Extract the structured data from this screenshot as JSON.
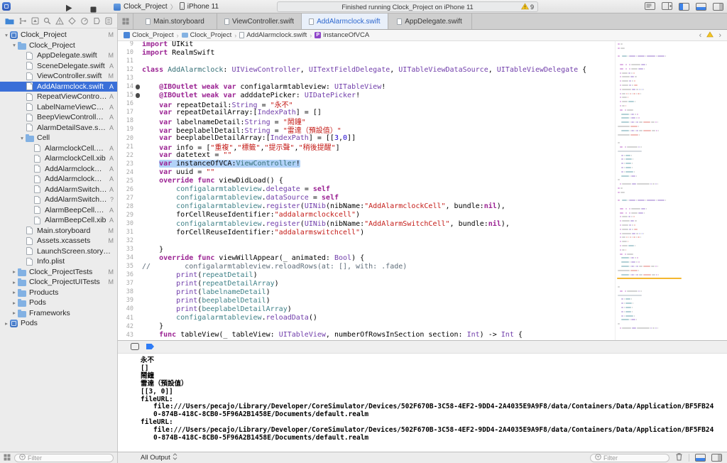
{
  "colors": {
    "selection_blue": "#3a6fd8",
    "tab_active_blue": "#2e68cf",
    "warning_yellow": "#f5c521",
    "keyword_pink": "#9B2393",
    "string_red": "#C41A16",
    "type_purple": "#703DAA",
    "member_teal": "#3E8087",
    "code_selection": "#b3d3f9"
  },
  "toolbar": {
    "scheme_project": "Clock_Project",
    "scheme_device": "iPhone 11",
    "status_text": "Finished running Clock_Project on iPhone 11",
    "warning_count": "9"
  },
  "tabs": [
    {
      "label": "Main.storyboard"
    },
    {
      "label": "ViewController.swift"
    },
    {
      "label": "AddAlarmclock.swift",
      "active": true
    },
    {
      "label": "AppDelegate.swift"
    }
  ],
  "breadcrumb": {
    "items": [
      {
        "label": "Clock_Project",
        "icon": "project"
      },
      {
        "label": "Clock_Project",
        "icon": "folder"
      },
      {
        "label": "AddAlarmclock.swift",
        "icon": "swift-file"
      },
      {
        "label": "instanceOfVCA",
        "icon": "symbol"
      }
    ]
  },
  "sidebar": {
    "filter_placeholder": "Filter",
    "items": [
      {
        "label": "Clock_Project",
        "indent": 0,
        "icon": "project",
        "disc": "open",
        "status": "M"
      },
      {
        "label": "Clock_Project",
        "indent": 1,
        "icon": "folder",
        "disc": "open"
      },
      {
        "label": "AppDelegate.swift",
        "indent": 2,
        "icon": "swift",
        "status": "M"
      },
      {
        "label": "SceneDelegate.swift",
        "indent": 2,
        "icon": "swift",
        "status": "A"
      },
      {
        "label": "ViewController.swift",
        "indent": 2,
        "icon": "swift",
        "status": "M"
      },
      {
        "label": "AddAlarmclock.swift",
        "indent": 2,
        "icon": "swift",
        "status": "A",
        "selected": true
      },
      {
        "label": "RepeatViewController.swift",
        "indent": 2,
        "icon": "swift",
        "status": "A"
      },
      {
        "label": "LabelNameViewController....",
        "indent": 2,
        "icon": "swift",
        "status": "A"
      },
      {
        "label": "BeepViewController.swift",
        "indent": 2,
        "icon": "swift",
        "status": "A"
      },
      {
        "label": "AlarmDetailSave.swift",
        "indent": 2,
        "icon": "swift",
        "status": "A"
      },
      {
        "label": "Cell",
        "indent": 2,
        "icon": "folder",
        "disc": "open"
      },
      {
        "label": "AlarmclockCell.swift",
        "indent": 3,
        "icon": "swift",
        "status": "A"
      },
      {
        "label": "AlarmclockCell.xib",
        "indent": 3,
        "icon": "xib",
        "status": "A"
      },
      {
        "label": "AddAlarmclockCell.swift",
        "indent": 3,
        "icon": "swift",
        "status": "A"
      },
      {
        "label": "AddAlarmclockCell.xib",
        "indent": 3,
        "icon": "xib",
        "status": "A"
      },
      {
        "label": "AddAlarmSwitchCell.swift",
        "indent": 3,
        "icon": "swift",
        "status": "A"
      },
      {
        "label": "AddAlarmSwitchCell.xib",
        "indent": 3,
        "icon": "xib",
        "status": "?"
      },
      {
        "label": "AlarmBeepCell.swift",
        "indent": 3,
        "icon": "swift",
        "status": "A"
      },
      {
        "label": "AlarmBeepCell.xib",
        "indent": 3,
        "icon": "xib",
        "status": "A"
      },
      {
        "label": "Main.storyboard",
        "indent": 2,
        "icon": "storyboard",
        "status": "M"
      },
      {
        "label": "Assets.xcassets",
        "indent": 2,
        "icon": "assets",
        "status": "M"
      },
      {
        "label": "LaunchScreen.storyboard",
        "indent": 2,
        "icon": "storyboard"
      },
      {
        "label": "Info.plist",
        "indent": 2,
        "icon": "plist"
      },
      {
        "label": "Clock_ProjectTests",
        "indent": 1,
        "icon": "folder",
        "disc": "closed",
        "status": "M"
      },
      {
        "label": "Clock_ProjectUITests",
        "indent": 1,
        "icon": "folder",
        "disc": "closed",
        "status": "M"
      },
      {
        "label": "Products",
        "indent": 1,
        "icon": "folder",
        "disc": "closed"
      },
      {
        "label": "Pods",
        "indent": 1,
        "icon": "folder",
        "disc": "closed"
      },
      {
        "label": "Frameworks",
        "indent": 1,
        "icon": "folder",
        "disc": "closed"
      },
      {
        "label": "Pods",
        "indent": 0,
        "icon": "project",
        "disc": "closed"
      }
    ]
  },
  "editor": {
    "lines": [
      {
        "num": 9,
        "seg": [
          [
            "k",
            "import"
          ],
          [
            "d",
            " UIKit"
          ]
        ]
      },
      {
        "num": 10,
        "seg": [
          [
            "k",
            "import"
          ],
          [
            "d",
            " RealmSwift"
          ]
        ]
      },
      {
        "num": 11,
        "seg": []
      },
      {
        "num": 12,
        "seg": [
          [
            "k",
            "class"
          ],
          [
            "d",
            " "
          ],
          [
            "p",
            "AddAlarmclock"
          ],
          [
            "d",
            ": "
          ],
          [
            "t",
            "UIViewController"
          ],
          [
            "d",
            ", "
          ],
          [
            "t",
            "UITextFieldDelegate"
          ],
          [
            "d",
            ", "
          ],
          [
            "t",
            "UITableViewDataSource"
          ],
          [
            "d",
            ", "
          ],
          [
            "t",
            "UITableViewDelegate"
          ],
          [
            "d",
            " {"
          ]
        ]
      },
      {
        "num": 13,
        "seg": []
      },
      {
        "num": 14,
        "badge": true,
        "seg": [
          [
            "d",
            "    "
          ],
          [
            "k",
            "@IBOutlet"
          ],
          [
            "d",
            " "
          ],
          [
            "k",
            "weak"
          ],
          [
            "d",
            " "
          ],
          [
            "k",
            "var"
          ],
          [
            "d",
            " configalarmtableview: "
          ],
          [
            "t",
            "UITableView"
          ],
          [
            "d",
            "!"
          ]
        ]
      },
      {
        "num": 15,
        "badge": true,
        "seg": [
          [
            "d",
            "    "
          ],
          [
            "k",
            "@IBOutlet"
          ],
          [
            "d",
            " "
          ],
          [
            "k",
            "weak"
          ],
          [
            "d",
            " "
          ],
          [
            "k",
            "var"
          ],
          [
            "d",
            " adddatePicker: "
          ],
          [
            "t",
            "UIDatePicker"
          ],
          [
            "d",
            "!"
          ]
        ]
      },
      {
        "num": 16,
        "seg": [
          [
            "d",
            "    "
          ],
          [
            "k",
            "var"
          ],
          [
            "d",
            " repeatDetail:"
          ],
          [
            "t",
            "String"
          ],
          [
            "d",
            " = "
          ],
          [
            "s",
            "\"永不\""
          ]
        ]
      },
      {
        "num": 17,
        "seg": [
          [
            "d",
            "    "
          ],
          [
            "k",
            "var"
          ],
          [
            "d",
            " repeatDetailArray:["
          ],
          [
            "t",
            "IndexPath"
          ],
          [
            "d",
            "] = []"
          ]
        ]
      },
      {
        "num": 18,
        "seg": [
          [
            "d",
            "    "
          ],
          [
            "k",
            "var"
          ],
          [
            "d",
            " labelnameDetail:"
          ],
          [
            "t",
            "String"
          ],
          [
            "d",
            " = "
          ],
          [
            "s",
            "\"鬧鐘\""
          ]
        ]
      },
      {
        "num": 19,
        "seg": [
          [
            "d",
            "    "
          ],
          [
            "k",
            "var"
          ],
          [
            "d",
            " beeplabelDetail:"
          ],
          [
            "t",
            "String"
          ],
          [
            "d",
            " = "
          ],
          [
            "s",
            "\"雷達（預設值）\""
          ]
        ]
      },
      {
        "num": 20,
        "seg": [
          [
            "d",
            "    "
          ],
          [
            "k",
            "var"
          ],
          [
            "d",
            " beeplabelDetailArray:["
          ],
          [
            "t",
            "IndexPath"
          ],
          [
            "d",
            "] = [["
          ],
          [
            "n",
            "3"
          ],
          [
            "d",
            ","
          ],
          [
            "n",
            "0"
          ],
          [
            "d",
            "]]"
          ]
        ]
      },
      {
        "num": 21,
        "seg": [
          [
            "d",
            "    "
          ],
          [
            "k",
            "var"
          ],
          [
            "d",
            " info = ["
          ],
          [
            "s",
            "\"重複\""
          ],
          [
            "d",
            ","
          ],
          [
            "s",
            "\"標籤\""
          ],
          [
            "d",
            ","
          ],
          [
            "s",
            "\"提示聲\""
          ],
          [
            "d",
            ","
          ],
          [
            "s",
            "\"稍後提醒\""
          ],
          [
            "d",
            "]"
          ]
        ]
      },
      {
        "num": 22,
        "seg": [
          [
            "d",
            "    "
          ],
          [
            "k",
            "var"
          ],
          [
            "d",
            " datetext = "
          ],
          [
            "s",
            "\"\""
          ]
        ]
      },
      {
        "num": 23,
        "hl": true,
        "seg": [
          [
            "d",
            "    "
          ],
          [
            "k",
            "var"
          ],
          [
            "d",
            " instanceOfVCA:"
          ],
          [
            "p",
            "ViewController"
          ],
          [
            "d",
            "!"
          ]
        ]
      },
      {
        "num": 24,
        "seg": [
          [
            "d",
            "    "
          ],
          [
            "k",
            "var"
          ],
          [
            "d",
            " uuid = "
          ],
          [
            "s",
            "\"\""
          ]
        ]
      },
      {
        "num": 25,
        "seg": [
          [
            "d",
            "    "
          ],
          [
            "k",
            "override"
          ],
          [
            "d",
            " "
          ],
          [
            "k",
            "func"
          ],
          [
            "d",
            " viewDidLoad() {"
          ]
        ]
      },
      {
        "num": 26,
        "seg": [
          [
            "d",
            "        "
          ],
          [
            "m",
            "configalarmtableview"
          ],
          [
            "d",
            "."
          ],
          [
            "t",
            "delegate"
          ],
          [
            "d",
            " = "
          ],
          [
            "k",
            "self"
          ]
        ]
      },
      {
        "num": 27,
        "seg": [
          [
            "d",
            "        "
          ],
          [
            "m",
            "configalarmtableview"
          ],
          [
            "d",
            "."
          ],
          [
            "t",
            "dataSource"
          ],
          [
            "d",
            " = "
          ],
          [
            "k",
            "self"
          ]
        ]
      },
      {
        "num": 28,
        "seg": [
          [
            "d",
            "        "
          ],
          [
            "m",
            "configalarmtableview"
          ],
          [
            "d",
            "."
          ],
          [
            "t",
            "register"
          ],
          [
            "d",
            "("
          ],
          [
            "t",
            "UINib"
          ],
          [
            "d",
            "(nibName:"
          ],
          [
            "s",
            "\"AddAlarmclockCell\""
          ],
          [
            "d",
            ", bundle:"
          ],
          [
            "k",
            "nil"
          ],
          [
            "d",
            "),"
          ]
        ]
      },
      {
        "num": 29,
        "seg": [
          [
            "d",
            "        forCellReuseIdentifier:"
          ],
          [
            "s",
            "\"addalarmclockcell\""
          ],
          [
            "d",
            ")"
          ]
        ]
      },
      {
        "num": 30,
        "seg": [
          [
            "d",
            "        "
          ],
          [
            "m",
            "configalarmtableview"
          ],
          [
            "d",
            "."
          ],
          [
            "t",
            "register"
          ],
          [
            "d",
            "("
          ],
          [
            "t",
            "UINib"
          ],
          [
            "d",
            "(nibName:"
          ],
          [
            "s",
            "\"AddAlarmSwitchCell\""
          ],
          [
            "d",
            ", bundle:"
          ],
          [
            "k",
            "nil"
          ],
          [
            "d",
            "),"
          ]
        ]
      },
      {
        "num": 31,
        "seg": [
          [
            "d",
            "        forCellReuseIdentifier:"
          ],
          [
            "s",
            "\"addalarmswitchcell\""
          ],
          [
            "d",
            ")"
          ]
        ]
      },
      {
        "num": 32,
        "seg": []
      },
      {
        "num": 33,
        "seg": [
          [
            "d",
            "    }"
          ]
        ]
      },
      {
        "num": 34,
        "seg": [
          [
            "d",
            "    "
          ],
          [
            "k",
            "override"
          ],
          [
            "d",
            " "
          ],
          [
            "k",
            "func"
          ],
          [
            "d",
            " viewWillAppear(_ animated: "
          ],
          [
            "t",
            "Bool"
          ],
          [
            "d",
            ") {"
          ]
        ]
      },
      {
        "num": 35,
        "seg": [
          [
            "c",
            "//        configalarmtableview.reloadRows(at: [], with: .fade)"
          ]
        ]
      },
      {
        "num": 36,
        "seg": [
          [
            "d",
            "        "
          ],
          [
            "t",
            "print"
          ],
          [
            "d",
            "("
          ],
          [
            "m",
            "repeatDetail"
          ],
          [
            "d",
            ")"
          ]
        ]
      },
      {
        "num": 37,
        "seg": [
          [
            "d",
            "        "
          ],
          [
            "t",
            "print"
          ],
          [
            "d",
            "("
          ],
          [
            "m",
            "repeatDetailArray"
          ],
          [
            "d",
            ")"
          ]
        ]
      },
      {
        "num": 38,
        "seg": [
          [
            "d",
            "        "
          ],
          [
            "t",
            "print"
          ],
          [
            "d",
            "("
          ],
          [
            "m",
            "labelnameDetail"
          ],
          [
            "d",
            ")"
          ]
        ]
      },
      {
        "num": 39,
        "seg": [
          [
            "d",
            "        "
          ],
          [
            "t",
            "print"
          ],
          [
            "d",
            "("
          ],
          [
            "m",
            "beeplabelDetail"
          ],
          [
            "d",
            ")"
          ]
        ]
      },
      {
        "num": 40,
        "seg": [
          [
            "d",
            "        "
          ],
          [
            "t",
            "print"
          ],
          [
            "d",
            "("
          ],
          [
            "m",
            "beeplabelDetailArray"
          ],
          [
            "d",
            ")"
          ]
        ]
      },
      {
        "num": 41,
        "seg": [
          [
            "d",
            "        "
          ],
          [
            "m",
            "configalarmtableview"
          ],
          [
            "d",
            "."
          ],
          [
            "t",
            "reloadData"
          ],
          [
            "d",
            "()"
          ]
        ]
      },
      {
        "num": 42,
        "seg": [
          [
            "d",
            "    }"
          ]
        ]
      },
      {
        "num": 43,
        "seg": [
          [
            "d",
            "    "
          ],
          [
            "k",
            "func"
          ],
          [
            "d",
            " tableView(_ tableView: "
          ],
          [
            "t",
            "UITableView"
          ],
          [
            "d",
            ", numberOfRowsInSection section: "
          ],
          [
            "t",
            "Int"
          ],
          [
            "d",
            ") -> "
          ],
          [
            "t",
            "Int"
          ],
          [
            "d",
            " {"
          ]
        ]
      }
    ]
  },
  "console": {
    "all_output_label": "All Output",
    "filter_placeholder": "Filter",
    "lines": [
      {
        "text": "永不"
      },
      {
        "text": "[]"
      },
      {
        "text": "鬧鐘"
      },
      {
        "text": "雷達（預設值）"
      },
      {
        "text": "[[3, 0]]"
      },
      {
        "text": "fileURL:"
      },
      {
        "text": "file:///Users/pecajo/Library/Developer/CoreSimulator/Devices/502F670B-3C58-4EF2-9DD4-2A4035E9A9F8/data/Containers/Data/Application/BF5FB24",
        "indent": true
      },
      {
        "text": "0-874B-418C-8CB0-5F96A2B1458E/Documents/default.realm",
        "indent": true
      },
      {
        "text": "fileURL:"
      },
      {
        "text": "file:///Users/pecajo/Library/Developer/CoreSimulator/Devices/502F670B-3C58-4EF2-9DD4-2A4035E9A9F8/data/Containers/Data/Application/BF5FB24",
        "indent": true
      },
      {
        "text": "0-874B-418C-8CB0-5F96A2B1458E/Documents/default.realm",
        "indent": true
      }
    ]
  }
}
